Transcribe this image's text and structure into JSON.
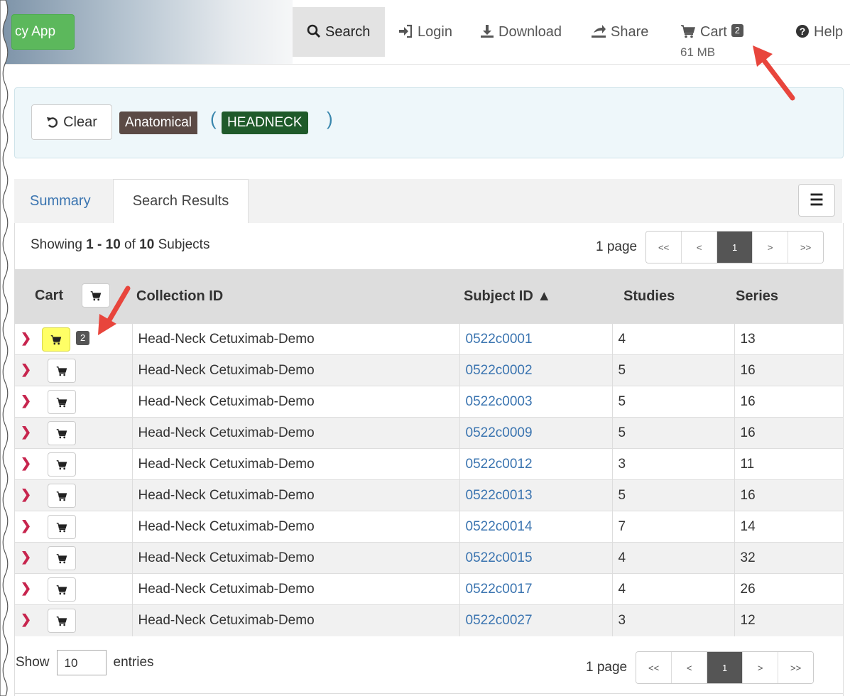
{
  "nav": {
    "app_label": "cy App",
    "search": "Search",
    "login": "Login",
    "download": "Download",
    "share": "Share",
    "cart": "Cart",
    "cart_count": "2",
    "cart_size": "61 MB",
    "help": "Help"
  },
  "filter": {
    "clear": "Clear",
    "category": "Anatomical",
    "open_paren": "(",
    "value": "HEADNECK",
    "close_paren": ")"
  },
  "tabs": {
    "summary": "Summary",
    "results": "Search Results",
    "menu": "☰"
  },
  "results": {
    "showing_prefix": "Showing ",
    "range": "1 - 10",
    "of": " of ",
    "total": "10",
    "unit": " Subjects"
  },
  "pager": {
    "label": "1 page",
    "first": "<<",
    "prev": "<",
    "current": "1",
    "next": ">",
    "last": ">>"
  },
  "table": {
    "headers": {
      "cart": "Cart",
      "collection": "Collection ID",
      "subject": "Subject ID ▲",
      "studies": "Studies",
      "series": "Series"
    },
    "rows": [
      {
        "collection": "Head-Neck Cetuximab-Demo",
        "subject": "0522c0001",
        "studies": "4",
        "series": "13",
        "badge": "2"
      },
      {
        "collection": "Head-Neck Cetuximab-Demo",
        "subject": "0522c0002",
        "studies": "5",
        "series": "16"
      },
      {
        "collection": "Head-Neck Cetuximab-Demo",
        "subject": "0522c0003",
        "studies": "5",
        "series": "16"
      },
      {
        "collection": "Head-Neck Cetuximab-Demo",
        "subject": "0522c0009",
        "studies": "5",
        "series": "16"
      },
      {
        "collection": "Head-Neck Cetuximab-Demo",
        "subject": "0522c0012",
        "studies": "3",
        "series": "11"
      },
      {
        "collection": "Head-Neck Cetuximab-Demo",
        "subject": "0522c0013",
        "studies": "5",
        "series": "16"
      },
      {
        "collection": "Head-Neck Cetuximab-Demo",
        "subject": "0522c0014",
        "studies": "7",
        "series": "14"
      },
      {
        "collection": "Head-Neck Cetuximab-Demo",
        "subject": "0522c0015",
        "studies": "4",
        "series": "32"
      },
      {
        "collection": "Head-Neck Cetuximab-Demo",
        "subject": "0522c0017",
        "studies": "4",
        "series": "26"
      },
      {
        "collection": "Head-Neck Cetuximab-Demo",
        "subject": "0522c0027",
        "studies": "3",
        "series": "12"
      }
    ]
  },
  "footer": {
    "show": "Show",
    "entries_value": "10",
    "entries": "entries"
  },
  "colors": {
    "accent_link": "#3a74b0",
    "filter_category": "#5b4a45",
    "filter_value": "#1f5a2a",
    "annotation_arrow": "#e8453c",
    "cart_added": "#ffff66"
  }
}
